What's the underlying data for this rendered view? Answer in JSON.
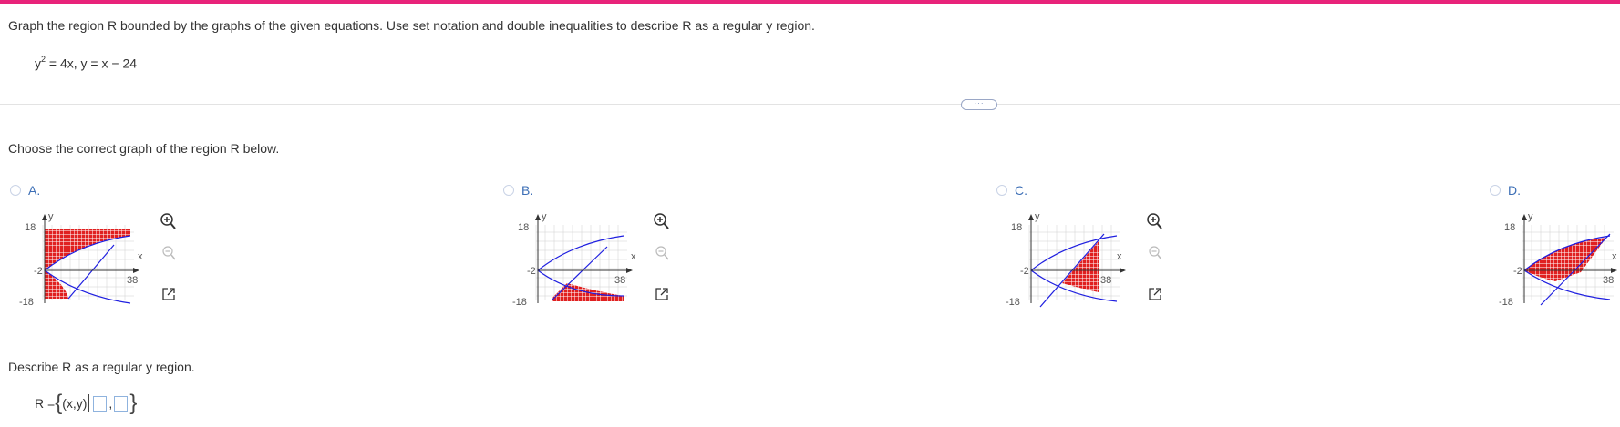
{
  "problem": {
    "instruction": "Graph the region R bounded by the graphs of the given equations.  Use set notation and double inequalities to describe R as a regular y region.",
    "equation_left": "y",
    "equation_exp": "2",
    "equation_right": " = 4x, y = x − 24"
  },
  "more_button": "···",
  "choose_prompt": "Choose the correct graph of the region R below.",
  "options": [
    {
      "letter": "A.",
      "y_top": "18",
      "y_mid": "-2",
      "y_bottom": "-18",
      "x_tick": "38",
      "y_label": "y",
      "x_label": "x"
    },
    {
      "letter": "B.",
      "y_top": "18",
      "y_mid": "-2",
      "y_bottom": "-18",
      "x_tick": "38",
      "y_label": "y",
      "x_label": "x"
    },
    {
      "letter": "C.",
      "y_top": "18",
      "y_mid": "-2",
      "y_bottom": "-18",
      "x_tick": "38",
      "y_label": "y",
      "x_label": "x"
    },
    {
      "letter": "D.",
      "y_top": "18",
      "y_mid": "-2",
      "y_bottom": "-18",
      "x_tick": "38",
      "y_label": "y",
      "x_label": "x"
    }
  ],
  "describe_prompt": "Describe R as a regular y region.",
  "answer": {
    "prefix": "R = ",
    "open_brace": "{",
    "set_var": "(x,y)",
    "comma": ",",
    "close_brace": "}"
  },
  "colors": {
    "accent_bar": "#e8237a",
    "curve": "#1f1fe0",
    "region": "#e02020",
    "option_letter": "#3d6fb6"
  },
  "icons": [
    "zoom-in-icon",
    "zoom-out-icon",
    "popout-icon",
    "radio-button"
  ]
}
